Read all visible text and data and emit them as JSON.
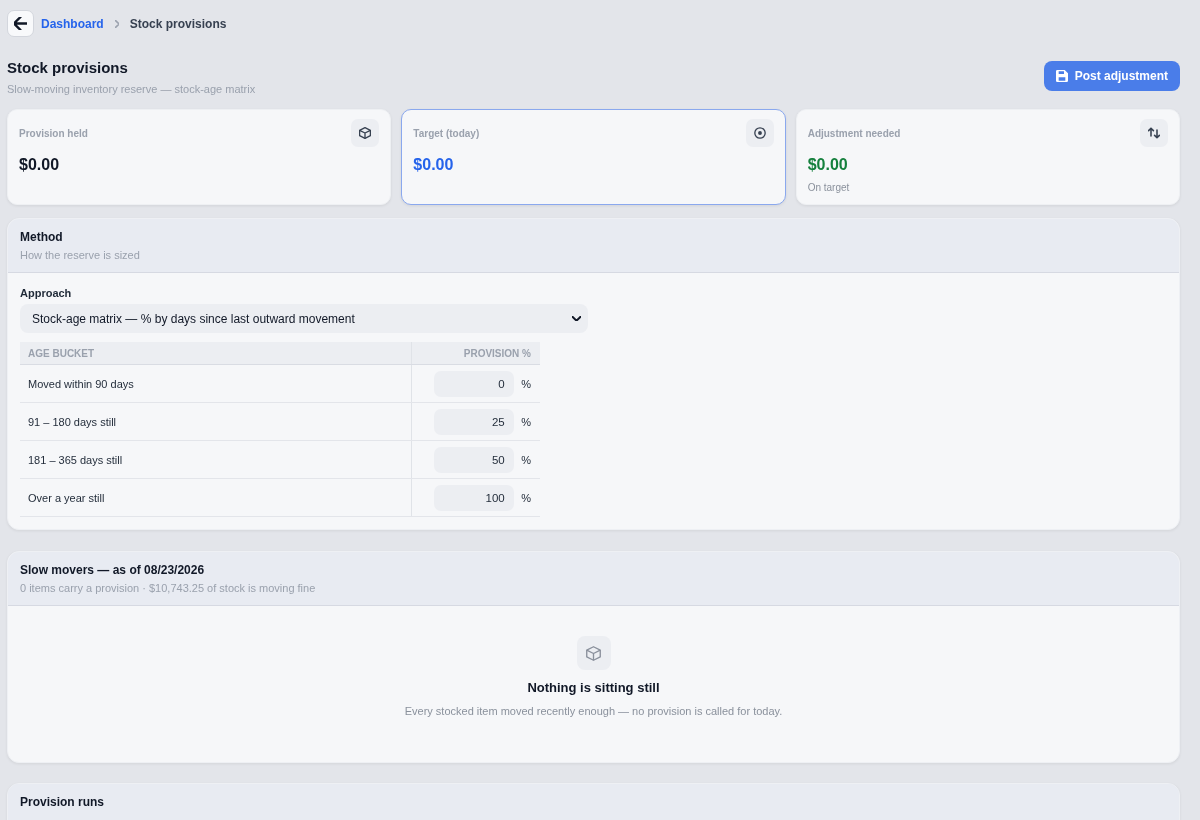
{
  "breadcrumb": [
    {
      "label": "Dashboard",
      "kind": "link"
    },
    {
      "label": "Stock provisions",
      "kind": "current"
    }
  ],
  "header": {
    "title": "Stock provisions",
    "subtitle": "Slow-moving inventory reserve — stock-age matrix",
    "action": "Post adjustment"
  },
  "stats": [
    {
      "kind": "held",
      "label": "Provision held",
      "value": "$0.00",
      "color": "#111827",
      "highlighted": false
    },
    {
      "kind": "target",
      "label": "Target (today)",
      "value": "$0.00",
      "color": "#2563eb",
      "highlighted": true
    },
    {
      "kind": "adjustment",
      "label": "Adjustment needed",
      "value": "$0.00",
      "color": "#15803d",
      "highlighted": false,
      "note": "On target"
    }
  ],
  "method": {
    "title": "Method",
    "subtitle": "How the reserve is sized",
    "approach_label": "Approach",
    "approach_value": "Stock-age matrix — % by days since last outward movement",
    "columns": [
      "AGE BUCKET",
      "PROVISION %"
    ],
    "rows": [
      {
        "bucket": "Moved within 90 days",
        "provision": "0",
        "unit": "%"
      },
      {
        "bucket": "91 – 180 days still",
        "provision": "25",
        "unit": "%"
      },
      {
        "bucket": "181 – 365 days still",
        "provision": "50",
        "unit": "%"
      },
      {
        "bucket": "Over a year still",
        "provision": "100",
        "unit": "%"
      }
    ]
  },
  "slow_movers": {
    "title": "Slow movers — as of 08/23/2026",
    "subtitle": "0 items carry a provision · $10,743.25 of stock is moving fine",
    "empty_state": {
      "title": "Nothing is sitting still",
      "message": "Every stocked item moved recently enough — no provision is called for today."
    }
  },
  "provision_runs": {
    "title": "Provision runs"
  }
}
